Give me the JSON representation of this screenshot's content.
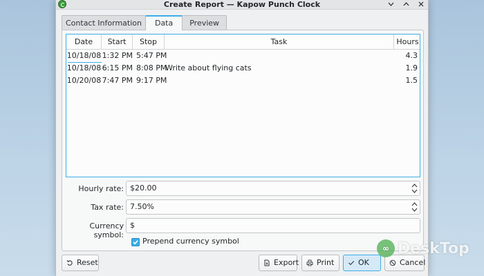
{
  "window": {
    "title": "Create Report — Kapow Punch Clock"
  },
  "tabs": [
    {
      "label": "Contact Information"
    },
    {
      "label": "Data"
    },
    {
      "label": "Preview"
    }
  ],
  "table": {
    "headers": {
      "date": "Date",
      "start": "Start",
      "stop": "Stop",
      "task": "Task",
      "hours": "Hours"
    },
    "rows": [
      {
        "date": "10/18/08",
        "start": "1:32 PM",
        "stop": "5:47 PM",
        "task": "",
        "hours": "4.3"
      },
      {
        "date": "10/18/08",
        "start": "6:15 PM",
        "stop": "8:08 PM",
        "task": "Write about flying cats",
        "hours": "1.9"
      },
      {
        "date": "10/20/08",
        "start": "7:47 PM",
        "stop": "9:17 PM",
        "task": "",
        "hours": "1.5"
      }
    ]
  },
  "form": {
    "hourly_rate_label": "Hourly rate:",
    "hourly_rate_value": "$20.00",
    "tax_rate_label": "Tax rate:",
    "tax_rate_value": "7.50%",
    "currency_label": "Currency symbol:",
    "currency_value": "$",
    "prepend_label": "Prepend currency symbol",
    "prepend_checked": true
  },
  "buttons": {
    "reset": "Reset",
    "export": "Export",
    "print": "Print",
    "ok": "OK",
    "cancel": "Cancel"
  },
  "watermark": {
    "text": "DeskTop"
  },
  "colors": {
    "accent": "#3daee9",
    "window_bg": "#eff0f1",
    "desktop_bg": "#bcd3e6"
  }
}
